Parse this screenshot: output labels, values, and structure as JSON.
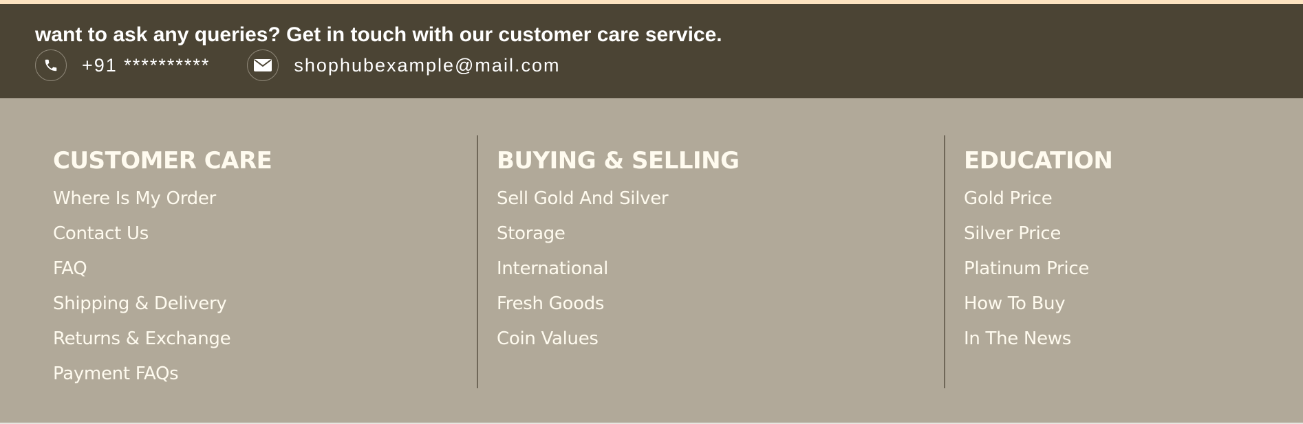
{
  "contact": {
    "heading": "want to ask any queries? Get in touch with our customer care service.",
    "phone_icon": "phone-icon",
    "phone": "+91 **********",
    "email_icon": "mail-icon",
    "email": "shophubexample@mail.com"
  },
  "footer": {
    "columns": [
      {
        "title": "CUSTOMER CARE",
        "links": [
          "Where Is My Order",
          "Contact Us",
          "FAQ",
          "Shipping & Delivery",
          "Returns & Exchange",
          "Payment FAQs"
        ]
      },
      {
        "title": "BUYING & SELLING",
        "links": [
          "Sell Gold And Silver",
          "Storage",
          "International",
          "Fresh Goods",
          "Coin Values"
        ]
      },
      {
        "title": "EDUCATION",
        "links": [
          "Gold Price",
          "Silver Price",
          "Platinum Price",
          "How To Buy",
          "In The News"
        ]
      }
    ]
  },
  "colors": {
    "top_strip": "#fce3c0",
    "contact_bar": "#4b4434",
    "footer_bg": "#b1a999",
    "footer_text": "#fffbef",
    "divider": "#6f6758"
  }
}
